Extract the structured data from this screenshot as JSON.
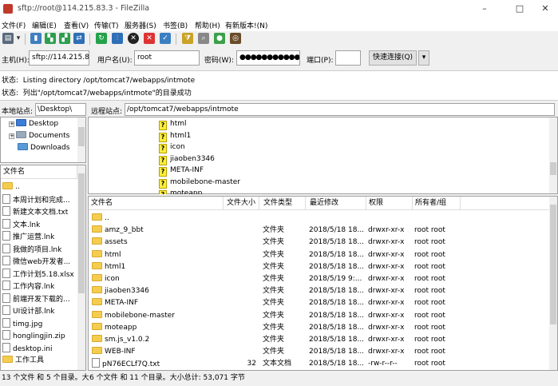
{
  "window": {
    "title": "sftp://root@114.215.83.3 - FileZilla",
    "minimize": "–",
    "maximize": "□",
    "close": "✕"
  },
  "menu": [
    "文件(F)",
    "编辑(E)",
    "查看(V)",
    "传输(T)",
    "服务器(S)",
    "书签(B)",
    "帮助(H)",
    "有新版本!(N)"
  ],
  "quickconnect": {
    "host_label": "主机(H):",
    "host_value": "sftp://114.215.83.",
    "user_label": "用户名(U):",
    "user_value": "root",
    "pass_label": "密码(W):",
    "pass_value": "●●●●●●●●●●●",
    "port_label": "端口(P):",
    "port_value": "",
    "connect_label": "快速连接(Q)",
    "dropdown": "▾"
  },
  "log": [
    {
      "label": "状态:",
      "text": "Listing directory /opt/tomcat7/webapps/intmote"
    },
    {
      "label": "状态:",
      "text": "列出\"/opt/tomcat7/webapps/intmote\"的目录成功"
    }
  ],
  "local": {
    "site_label": "本地站点:",
    "site_value": "\\Desktop\\",
    "tree": [
      {
        "expander": "+",
        "label": "Desktop"
      },
      {
        "expander": "+",
        "label": "Documents"
      },
      {
        "expander": "",
        "label": "Downloads"
      }
    ],
    "column_name": "文件名",
    "files": [
      "..",
      "本周计划和完成...",
      "新建文本文档.txt",
      "文本.lnk",
      "推广运营.lnk",
      "我做的项目.lnk",
      "微信web开发者...",
      "工作计划5.18.xlsx",
      "工作内容.lnk",
      "前端开发下载的...",
      "UI设计部.lnk",
      "timg.jpg",
      "honglingjin.zip",
      "desktop.ini",
      "工作工具"
    ],
    "status": "13 个文件 和 5 个目录。大"
  },
  "remote": {
    "site_label": "远程站点:",
    "site_value": "/opt/tomcat7/webapps/intmote",
    "tree": [
      "html",
      "html1",
      "icon",
      "jiaoben3346",
      "META-INF",
      "mobilebone-master",
      "moteapp"
    ],
    "columns": {
      "name": "文件名",
      "size": "文件大小",
      "type": "文件类型",
      "modified": "最近修改",
      "perms": "权限",
      "owner": "所有者/组"
    },
    "files": [
      {
        "name": "..",
        "size": "",
        "type": "",
        "modified": "",
        "perms": "",
        "owner": ""
      },
      {
        "name": "amz_9_bbt",
        "size": "",
        "type": "文件夹",
        "modified": "2018/5/18 18...",
        "perms": "drwxr-xr-x",
        "owner": "root root"
      },
      {
        "name": "assets",
        "size": "",
        "type": "文件夹",
        "modified": "2018/5/18 18...",
        "perms": "drwxr-xr-x",
        "owner": "root root"
      },
      {
        "name": "html",
        "size": "",
        "type": "文件夹",
        "modified": "2018/5/18 18...",
        "perms": "drwxr-xr-x",
        "owner": "root root"
      },
      {
        "name": "html1",
        "size": "",
        "type": "文件夹",
        "modified": "2018/5/18 18...",
        "perms": "drwxr-xr-x",
        "owner": "root root"
      },
      {
        "name": "icon",
        "size": "",
        "type": "文件夹",
        "modified": "2018/5/19 9:...",
        "perms": "drwxr-xr-x",
        "owner": "root root"
      },
      {
        "name": "jiaoben3346",
        "size": "",
        "type": "文件夹",
        "modified": "2018/5/18 18...",
        "perms": "drwxr-xr-x",
        "owner": "root root"
      },
      {
        "name": "META-INF",
        "size": "",
        "type": "文件夹",
        "modified": "2018/5/18 18...",
        "perms": "drwxr-xr-x",
        "owner": "root root"
      },
      {
        "name": "mobilebone-master",
        "size": "",
        "type": "文件夹",
        "modified": "2018/5/18 18...",
        "perms": "drwxr-xr-x",
        "owner": "root root"
      },
      {
        "name": "moteapp",
        "size": "",
        "type": "文件夹",
        "modified": "2018/5/18 18...",
        "perms": "drwxr-xr-x",
        "owner": "root root"
      },
      {
        "name": "sm.js_v1.0.2",
        "size": "",
        "type": "文件夹",
        "modified": "2018/5/18 18...",
        "perms": "drwxr-xr-x",
        "owner": "root root"
      },
      {
        "name": "WEB-INF",
        "size": "",
        "type": "文件夹",
        "modified": "2018/5/18 18...",
        "perms": "drwxr-xr-x",
        "owner": "root root"
      },
      {
        "name": "pN76ECLf7Q.txt",
        "size": "32",
        "type": "文本文档",
        "modified": "2018/5/18 18...",
        "perms": "-rw-r--r--",
        "owner": "root root"
      }
    ],
    "status": "6 个文件 和 11 个目录。大小总计: 53,071 字节"
  },
  "colors": {
    "folder": "#f5cd4e",
    "unknown_icon": "#ffef3a"
  }
}
